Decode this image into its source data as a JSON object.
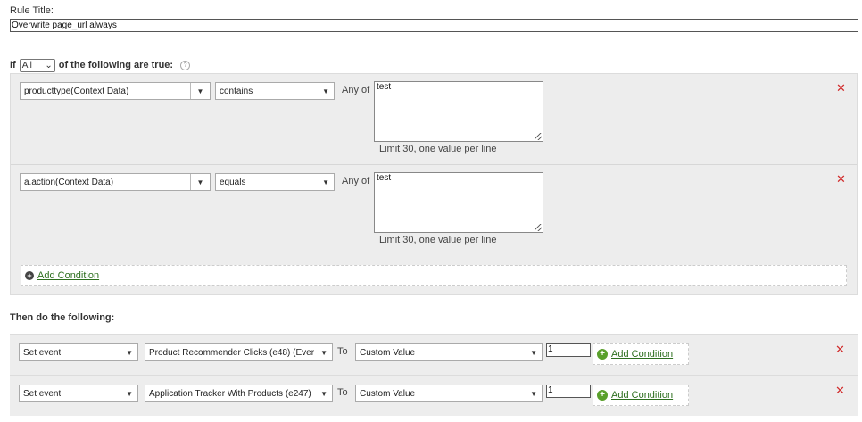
{
  "rule_title": {
    "label": "Rule Title:",
    "value": "Overwrite page_url always"
  },
  "if_clause": {
    "prefix": "If",
    "selector_value": "All",
    "suffix": "of the following are true:",
    "help_icon": "help-icon"
  },
  "conditions": [
    {
      "variable": "producttype(Context Data)",
      "operator": "contains",
      "any_of_label": "Any of",
      "values": "test",
      "limit_note": "Limit 30, one value per line",
      "remove_icon": "close-icon"
    },
    {
      "variable": "a.action(Context Data)",
      "operator": "equals",
      "any_of_label": "Any of",
      "values": "test",
      "limit_note": "Limit 30, one value per line",
      "remove_icon": "close-icon"
    }
  ],
  "add_condition_label": "Add Condition",
  "then_heading": "Then do the following:",
  "actions": [
    {
      "action": "Set event",
      "target": "Product Recommender Clicks (e48) (Ever",
      "to_label": "To",
      "value_type": "Custom Value",
      "value": "1",
      "add_condition_label": "Add Condition",
      "remove_icon": "close-icon"
    },
    {
      "action": "Set event",
      "target": "Application Tracker With Products (e247)",
      "to_label": "To",
      "value_type": "Custom Value",
      "value": "1",
      "add_condition_label": "Add Condition",
      "remove_icon": "close-icon"
    }
  ],
  "colors": {
    "panel_bg": "#ededed",
    "remove_red": "#d12b2b",
    "link_green": "#2d6f1e",
    "plus_green": "#5aa02c"
  }
}
